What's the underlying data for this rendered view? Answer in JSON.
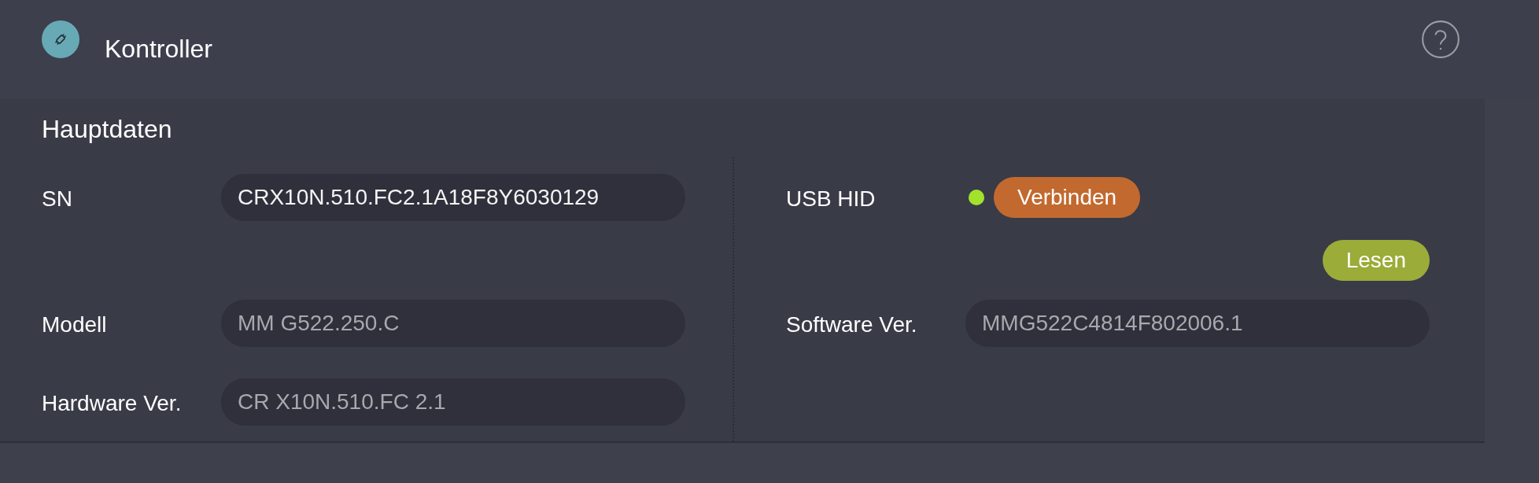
{
  "header": {
    "title": "Kontroller"
  },
  "section": {
    "title": "Hauptdaten",
    "left_fields": [
      {
        "label": "SN",
        "value": "CRX10N.510.FC2.1A18F8Y6030129",
        "disabled": false
      },
      {
        "label": "Modell",
        "value": "MM G522.250.C",
        "disabled": true
      },
      {
        "label": "Hardware Ver.",
        "value": "CR X10N.510.FC 2.1",
        "disabled": true
      }
    ],
    "usb": {
      "label": "USB HID",
      "connected": true,
      "button": "Verbinden"
    },
    "read_button": "Lesen",
    "right_fields": [
      {
        "label": "Software Ver.",
        "value": "MMG522C4814F802006.1",
        "disabled": true
      }
    ]
  }
}
